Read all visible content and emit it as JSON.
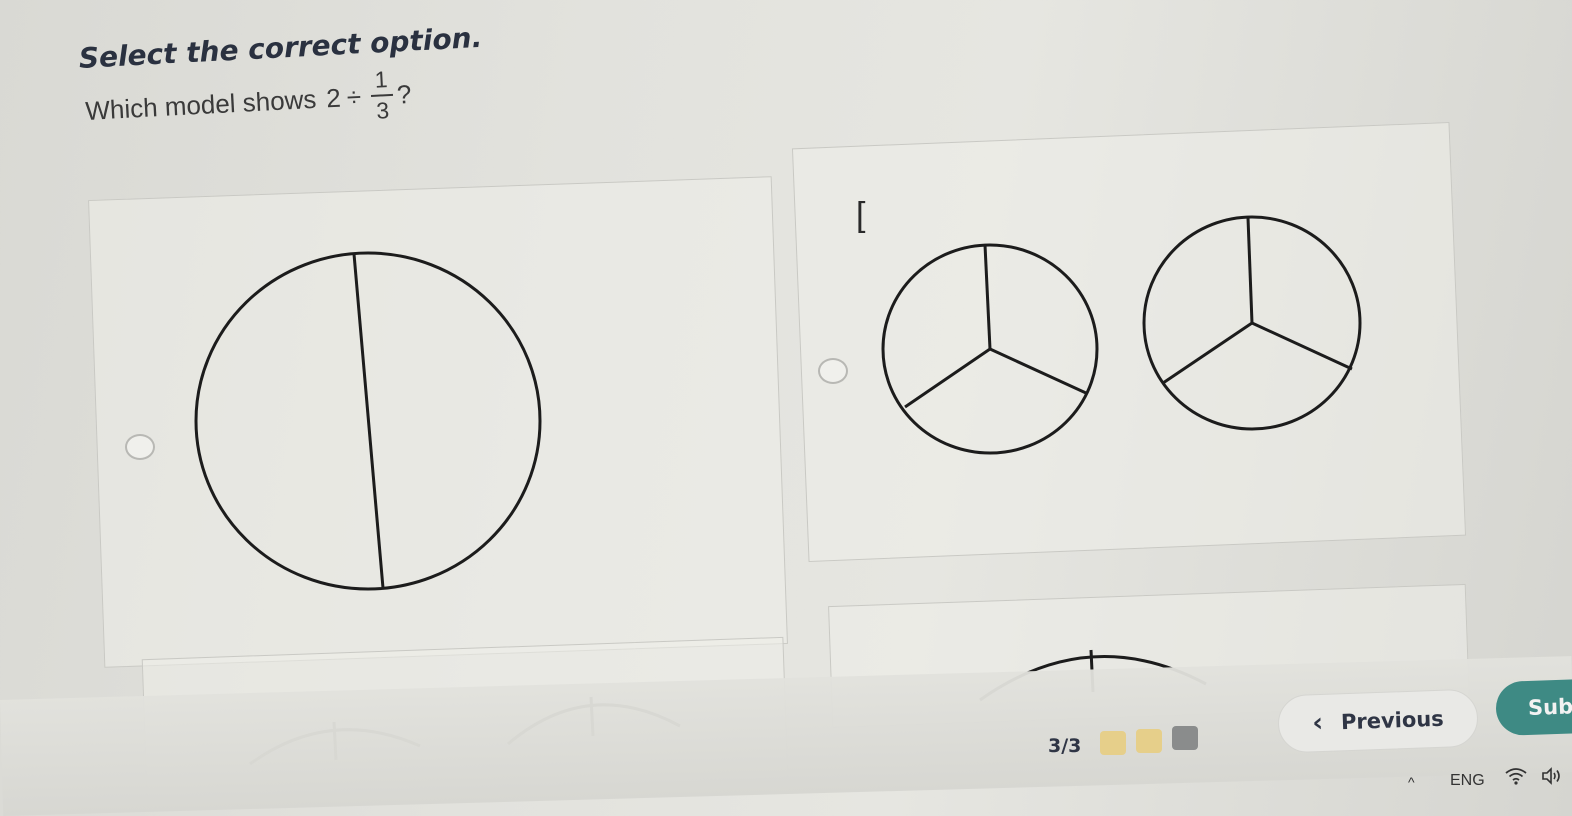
{
  "instruction": "Select the correct option.",
  "question": {
    "prefix": "Which model shows",
    "whole": "2",
    "operator": "÷",
    "numerator": "1",
    "denominator": "3",
    "suffix": "?"
  },
  "options": [
    {
      "id": "a",
      "circles": 1,
      "parts_per_circle": 2
    },
    {
      "id": "b",
      "circles": 2,
      "parts_per_circle": 3
    }
  ],
  "footer": {
    "progress": "3/3",
    "previous_label": "Previous",
    "submit_label": "Sub",
    "progress_colors": [
      "#e6cf8a",
      "#e6cf8a",
      "#8a8c8c"
    ]
  },
  "taskbar": {
    "chevron": "^",
    "language": "ENG",
    "wifi_icon": "wifi-icon",
    "volume_icon": "volume-icon"
  }
}
